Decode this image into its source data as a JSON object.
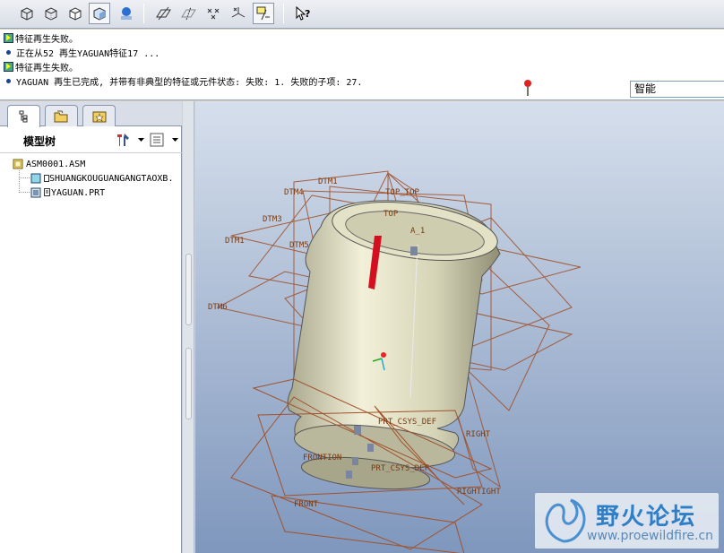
{
  "toolbar": {
    "buttons": [
      {
        "name": "wireframe-icon"
      },
      {
        "name": "hidden-line-icon"
      },
      {
        "name": "no-hidden-icon"
      },
      {
        "name": "shading-icon"
      },
      {
        "name": "enhanced-realism-icon"
      },
      {
        "name": "datum-planes-icon"
      },
      {
        "name": "datum-axes-icon"
      },
      {
        "name": "datum-points-icon"
      },
      {
        "name": "coordinate-systems-icon"
      },
      {
        "name": "annotations-icon"
      },
      {
        "name": "context-help-icon"
      }
    ]
  },
  "messages": [
    {
      "type": "warning",
      "text": "特征再生失败。"
    },
    {
      "type": "info",
      "text": "正在从52 再生YAGUAN特征17 ..."
    },
    {
      "type": "warning",
      "text": "特征再生失败。"
    },
    {
      "type": "info",
      "text": "YAGUAN 再生已完成, 并带有非典型的特征或元件状态: 失败: 1. 失败的子项: 27."
    }
  ],
  "filter": {
    "value": "智能"
  },
  "left_panel": {
    "title": "模型树",
    "tabs": [
      "model-tree-tab",
      "folder-browser-tab",
      "favorites-tab"
    ]
  },
  "tree": {
    "root": "ASM0001.ASM",
    "children": [
      "SHUANGKOUGUANGANGTAOXB.",
      "YAGUAN.PRT"
    ]
  },
  "viewport": {
    "datum_labels": [
      "DTM1",
      "DTM4",
      "DTM3",
      "DTM1",
      "DTM5",
      "TOP_TOP",
      "TOP",
      "A_1",
      "DTM6",
      "PRT_CSYS_DEF",
      "RIGHT",
      "FRONTION",
      "PRT_CSYS_DEF",
      "RIGHTIGHT",
      "FRONT"
    ]
  },
  "watermark": {
    "title": "野火论坛",
    "url": "www.proewildfire.cn"
  },
  "colors": {
    "viewport_top": "#d6dfec",
    "viewport_bottom": "#7f97bd",
    "datum": "#a0522d",
    "part": "#e9e7c9"
  }
}
